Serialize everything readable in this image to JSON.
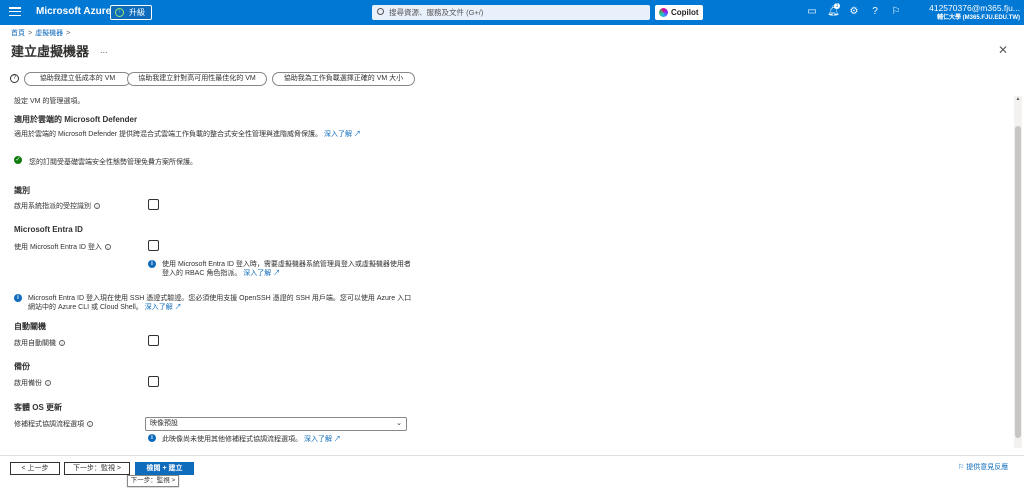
{
  "topbar": {
    "brand": "Microsoft Azure",
    "upgrade_label": "升級",
    "search_placeholder": "搜尋資源、服務及文件 (G+/)",
    "copilot_label": "Copilot",
    "notification_count": "1",
    "account_email": "412570376@m365.fju...",
    "account_org": "輔仁大學 (M365.FJU.EDU.TW)"
  },
  "breadcrumb": {
    "home": "首頁",
    "vm": "虛擬機器"
  },
  "page": {
    "title": "建立虛擬機器",
    "more": "..."
  },
  "help_buttons": [
    "協助我建立低成本的 VM",
    "協助我建立針對高可用性最佳化的 VM",
    "協助我為工作負載選擇正確的 VM 大小"
  ],
  "content": {
    "intro": "設定 VM 的管理選項。",
    "defender_heading": "適用於雲端的 Microsoft Defender",
    "defender_desc": "適用於雲端的 Microsoft Defender 提供跨混合式雲端工作負載的整合式安全性管理與進階威脅保護。",
    "learn_more": "深入了解",
    "defender_status": "您的訂閱受基礎雲端安全性態勢管理免費方案所保護。",
    "identity_heading": "識別",
    "identity_label": "啟用系統指派的受控識別",
    "entra_heading": "Microsoft Entra ID",
    "entra_label": "使用 Microsoft Entra ID 登入",
    "entra_info": "使用 Microsoft Entra ID 登入時，需要虛擬機器系統管理員登入或虛擬機器使用者登入的 RBAC 角色指派。",
    "ssh_info": "Microsoft Entra ID 登入現在使用 SSH 憑證式驗證。您必須使用支援 OpenSSH 憑證的 SSH 用戶端。您可以使用 Azure 入口網站中的 Azure CLI 或 Cloud Shell。",
    "autoshutdown_heading": "自動關機",
    "autoshutdown_label": "啟用自動關機",
    "backup_heading": "備份",
    "backup_label": "啟用備份",
    "guestos_heading": "客體 OS 更新",
    "patch_label": "修補程式協調流程選項",
    "patch_value": "映像預設",
    "patch_info": "此映像尚未使用其他修補程式協調流程選項。"
  },
  "footer": {
    "prev": "< 上一步",
    "next": "下一步：監視 >",
    "review": "檢閱 + 建立",
    "tooltip": "下一步：監視 >",
    "feedback": "提供意見反應"
  }
}
